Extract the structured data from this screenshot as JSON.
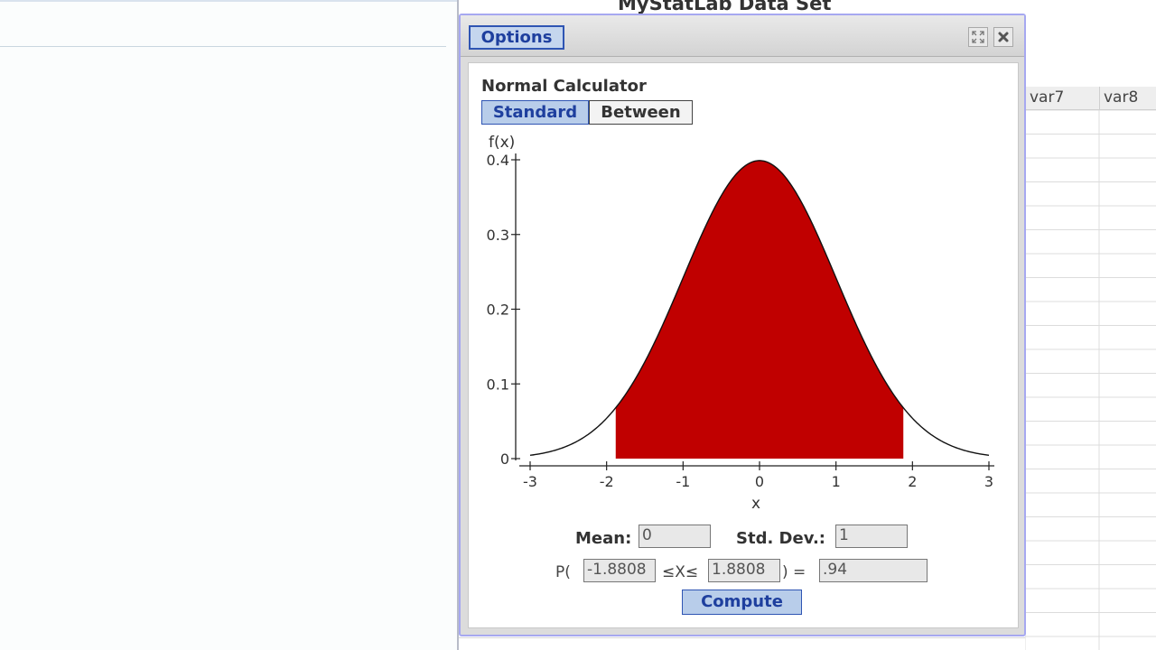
{
  "window": {
    "background_title": "MyStatLab Data Set",
    "options_label": "Options",
    "expand_icon": "expand-icon",
    "close_icon": "close-icon"
  },
  "spreadsheet": {
    "columns": [
      "var7",
      "var8"
    ]
  },
  "calculator": {
    "title": "Normal Calculator",
    "tabs": [
      {
        "label": "Standard",
        "active": true
      },
      {
        "label": "Between",
        "active": false
      }
    ],
    "mean_label": "Mean:",
    "mean_value": "0",
    "sd_label": "Std. Dev.:",
    "sd_value": "1",
    "prob_prefix": "P(",
    "lower_value": "-1.8808",
    "between_symbol": "≤X≤",
    "upper_value": "1.8808",
    "prob_suffix": ") =",
    "result_value": ".94",
    "compute_label": "Compute"
  },
  "chart_data": {
    "type": "area",
    "distribution": "normal",
    "mean": 0,
    "sd": 1,
    "xlabel": "x",
    "ylabel": "f(x)",
    "xlim": [
      -3,
      3
    ],
    "ylim": [
      0,
      0.4
    ],
    "x_ticks": [
      -3,
      -2,
      -1,
      0,
      1,
      2,
      3
    ],
    "y_ticks": [
      0,
      0.1,
      0.2,
      0.3,
      0.4
    ],
    "y_tick_labels": [
      "0",
      "0.1",
      "0.2",
      "0.3",
      "0.4"
    ],
    "shaded_interval": [
      -1.8808,
      1.8808
    ],
    "shade_color": "#c00000",
    "grid": false
  }
}
